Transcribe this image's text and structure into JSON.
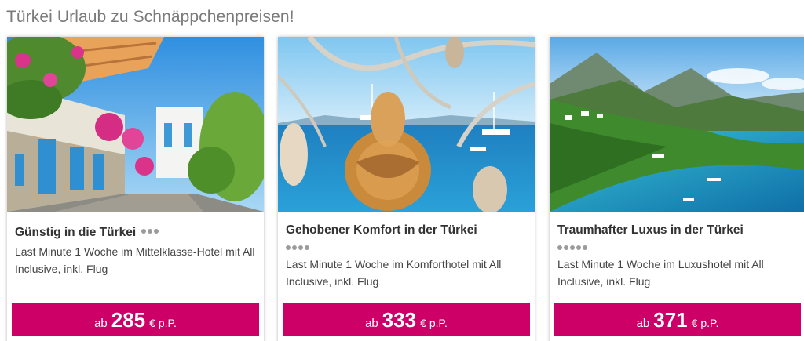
{
  "section": {
    "title": "Türkei Urlaub zu Schnäppchenpreisen!"
  },
  "colors": {
    "accent": "#cc0066",
    "title_gray": "#7a7a7a",
    "star_gray": "#9b9b9b"
  },
  "cards": [
    {
      "title": "Günstig in die Türkei",
      "stars": 3,
      "image": "whitewashed-street-with-bougainvillea",
      "description": "Last Minute 1 Woche im Mittelklasse-Hotel mit All Inclusive, inkl. Flug",
      "price_prefix": "ab",
      "price": "285",
      "price_suffix": "€ p.P."
    },
    {
      "title": "Gehobener Komfort in der Türkei",
      "stars": 4,
      "image": "gourd-lamps-by-the-sea",
      "description": "Last Minute 1 Woche im Komforthotel mit All Inclusive, inkl. Flug",
      "price_prefix": "ab",
      "price": "333",
      "price_suffix": "€ p.P."
    },
    {
      "title": "Traumhafter Luxus in der Türkei",
      "stars": 5,
      "image": "turquoise-bay-with-mountains",
      "description": "Last Minute 1 Woche im Luxushotel mit All Inclusive, inkl. Flug",
      "price_prefix": "ab",
      "price": "371",
      "price_suffix": "€ p.P."
    }
  ]
}
